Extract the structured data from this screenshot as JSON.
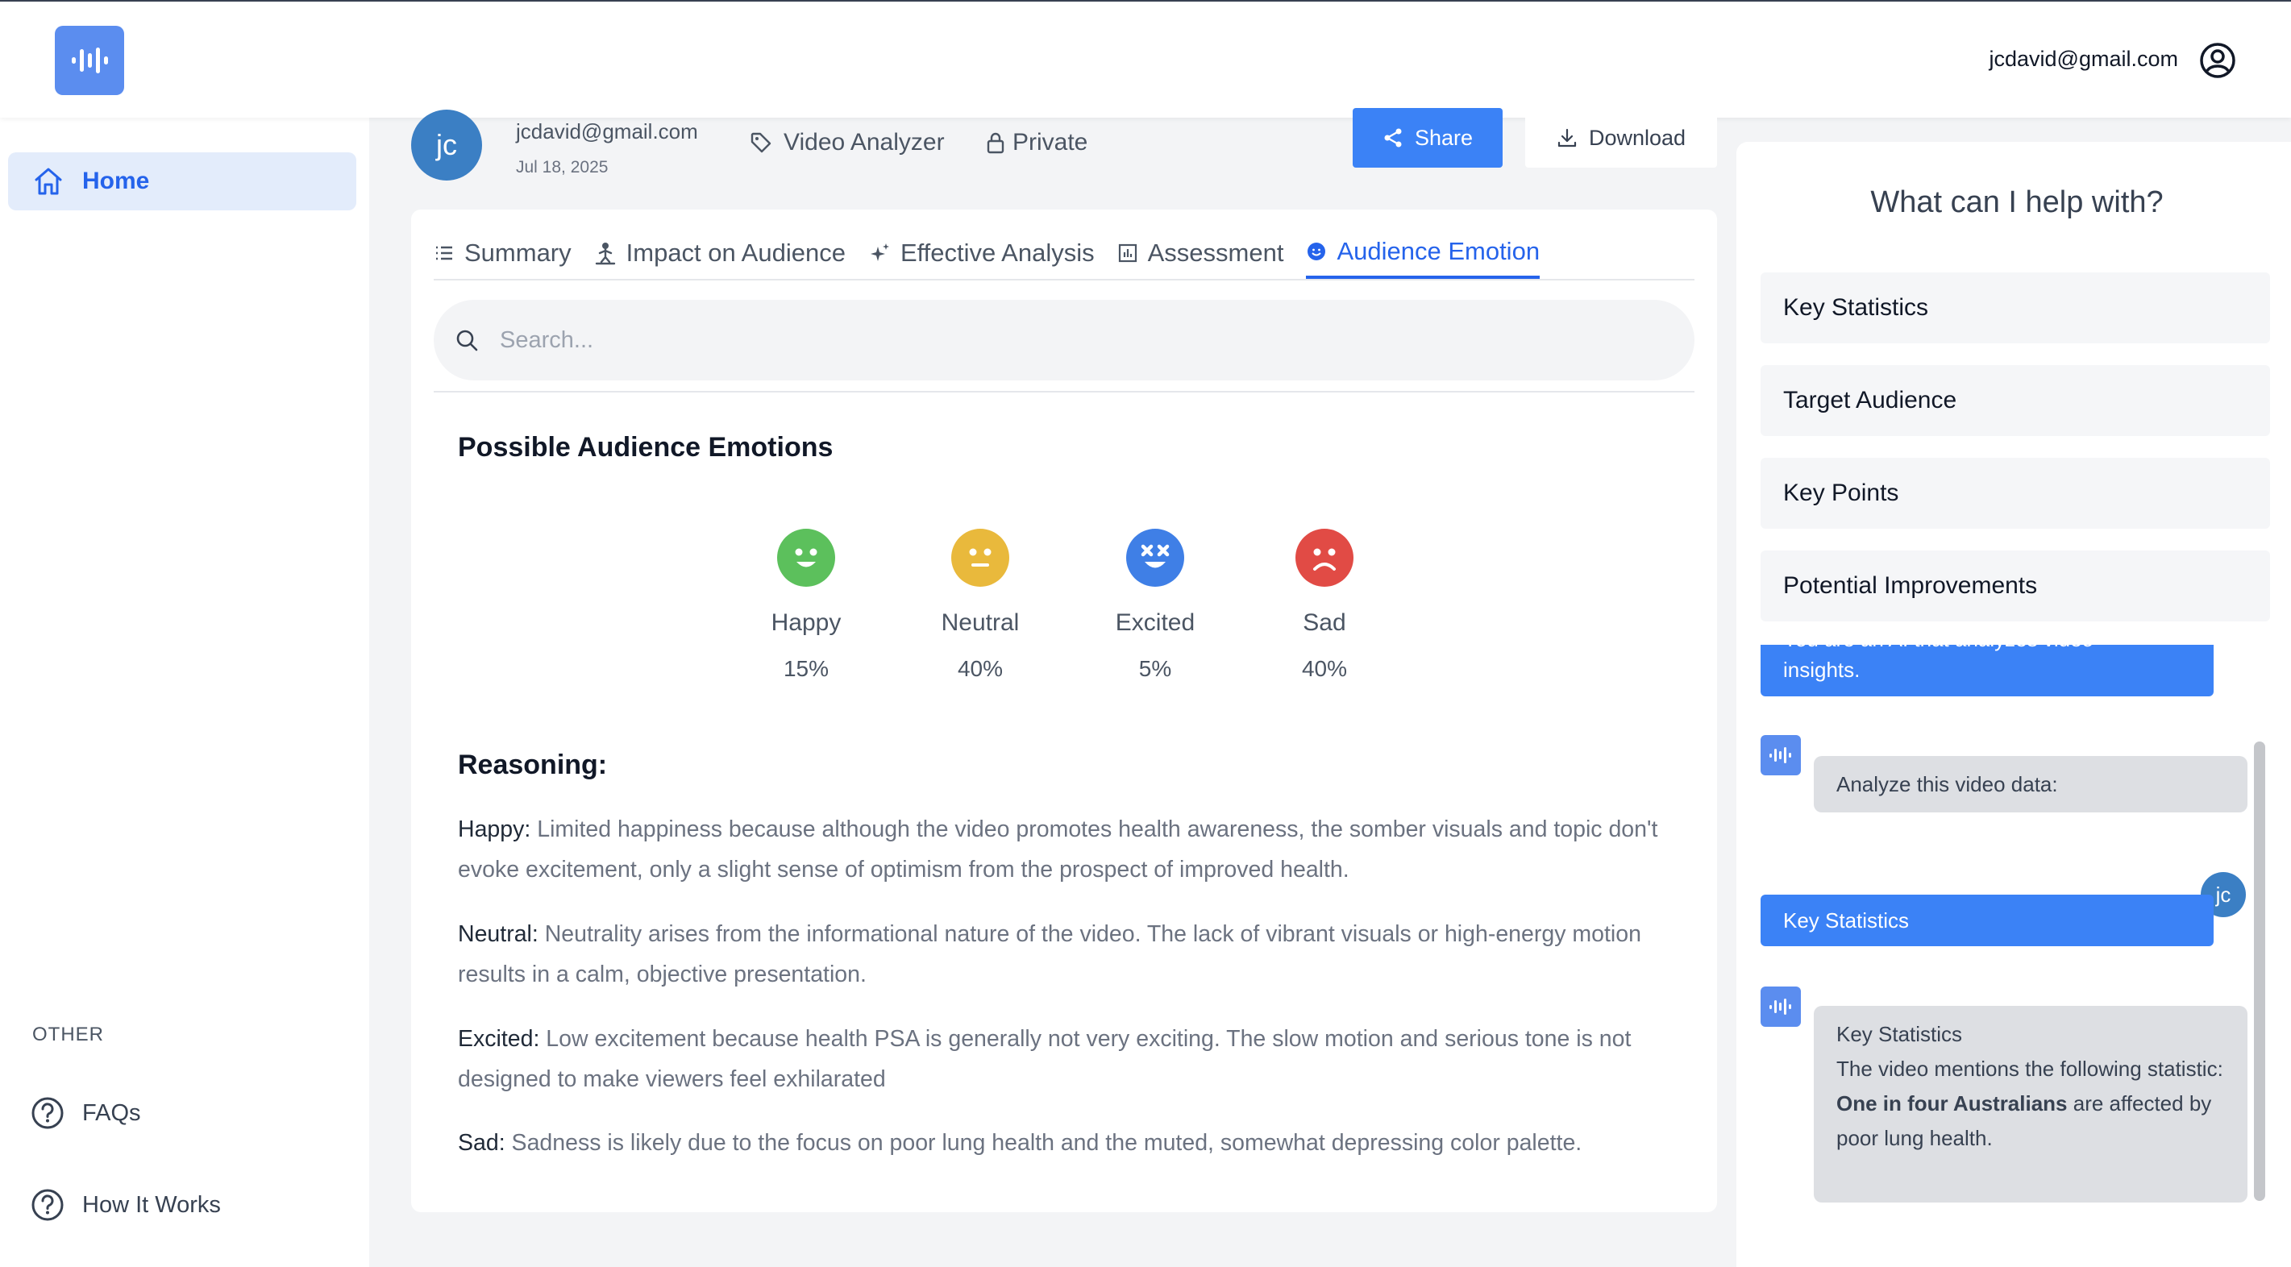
{
  "header": {
    "email": "jcdavid@gmail.com"
  },
  "sidebar": {
    "home_label": "Home",
    "other_label": "OTHER",
    "faqs_label": "FAQs",
    "how_it_works_label": "How It Works"
  },
  "video": {
    "avatar_initials": "jc",
    "owner_email": "jcdavid@gmail.com",
    "date": "Jul 18, 2025",
    "tag": "Video Analyzer",
    "visibility": "Private",
    "share_label": "Share",
    "download_label": "Download"
  },
  "tabs": [
    {
      "label": "Summary",
      "icon": "list-icon",
      "active": false
    },
    {
      "label": "Impact on Audience",
      "icon": "person-icon",
      "active": false
    },
    {
      "label": "Effective Analysis",
      "icon": "sparkle-icon",
      "active": false
    },
    {
      "label": "Assessment",
      "icon": "chart-icon",
      "active": false
    },
    {
      "label": "Audience Emotion",
      "icon": "smile-icon",
      "active": true
    }
  ],
  "search": {
    "placeholder": "Search..."
  },
  "emotions": {
    "title": "Possible Audience Emotions",
    "items": [
      {
        "label": "Happy",
        "percent": "15%",
        "color": "#5cc05c"
      },
      {
        "label": "Neutral",
        "percent": "40%",
        "color": "#e9b93c"
      },
      {
        "label": "Excited",
        "percent": "5%",
        "color": "#3f7fe6"
      },
      {
        "label": "Sad",
        "percent": "40%",
        "color": "#e14b45"
      }
    ]
  },
  "reasoning": {
    "title": "Reasoning:",
    "items": [
      {
        "key": "Happy:",
        "text": " Limited happiness because although the video promotes health awareness, the somber visuals and topic don't evoke excitement, only a slight sense of optimism from the prospect of improved health."
      },
      {
        "key": "Neutral:",
        "text": " Neutrality arises from the informational nature of the video. The lack of vibrant visuals or high-energy motion results in a calm, objective presentation."
      },
      {
        "key": "Excited:",
        "text": " Low excitement because health PSA is generally not very exciting. The slow motion and serious tone is not designed to make viewers feel exhilarated"
      },
      {
        "key": "Sad:",
        "text": " Sadness is likely due to the focus on poor lung health and the muted, somewhat depressing color palette."
      }
    ]
  },
  "assistant": {
    "title": "What can I help with?",
    "suggestions": [
      "Key Statistics",
      "Target Audience",
      "Key Points",
      "Potential Improvements"
    ],
    "messages": {
      "system_partial": "You are an AI that analyzes video",
      "system_tail": "insights.",
      "bot_prompt": "Analyze this video data:",
      "user_initials": "jc",
      "user_msg": "Key Statistics",
      "reply_title": "Key Statistics",
      "reply_line1": "The video mentions the following statistic:",
      "reply_bold": "One in four Australians",
      "reply_rest": " are affected by poor lung health."
    }
  }
}
